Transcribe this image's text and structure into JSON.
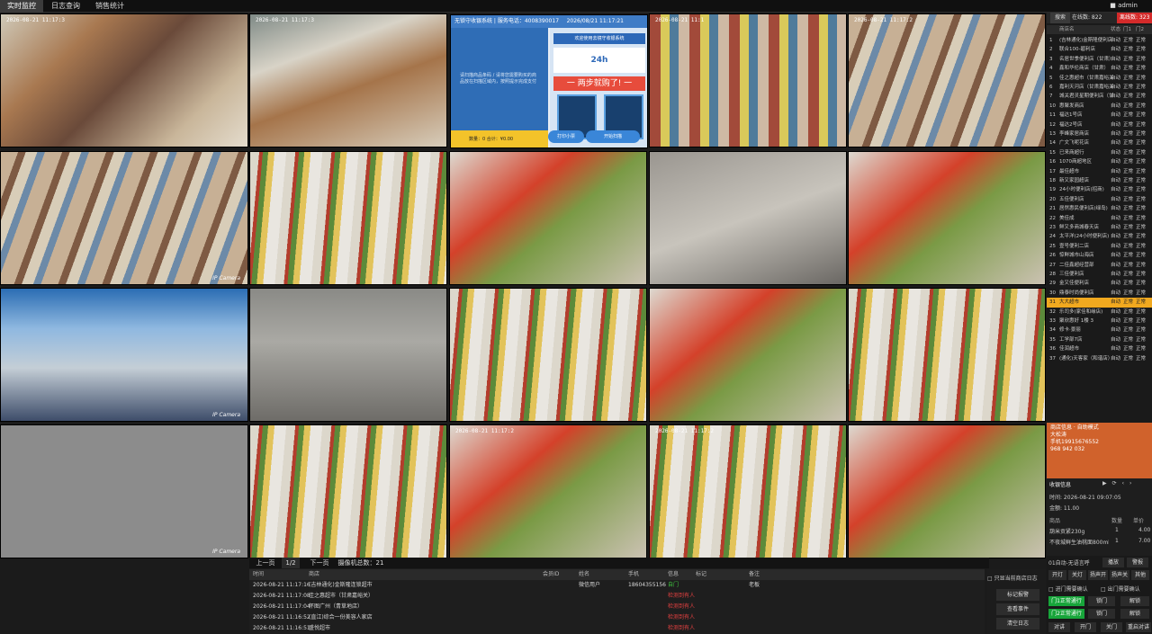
{
  "tabs": [
    {
      "label": "实时监控",
      "active": true
    },
    {
      "label": "日志查询",
      "active": false
    },
    {
      "label": "销售统计",
      "active": false
    }
  ],
  "user": {
    "name": "admin"
  },
  "cameras": {
    "timestamps": [
      "2026-08-21 11:17:3",
      "2026-08-21 11:17:3",
      "",
      "2026-08-21 11:1",
      "2026-08-21 11:17:2",
      "",
      "",
      "",
      "",
      "",
      "",
      "",
      "",
      "",
      "",
      "",
      "",
      "2026-08-21 11:17:2",
      "2026-08-21 11:17:2"
    ],
    "labels": [
      "IP Camera",
      "IP Camera",
      "IP Camera"
    ]
  },
  "pos_screen": {
    "header": "无锁守收银系统 | 服务电话：4008390017",
    "datetime": "2026/08/21 11:17:21",
    "message": "请扫描商品条码 / 请将您需要购买的商品放在扫描区域内，按照提示完成支付",
    "totals": "数量：0  合计：¥0.00",
    "ad_title": "欢迎使用去镜守收银系统",
    "ad_24h": "24h",
    "ad_slogan": "一 两步就购了! 一",
    "btn_left": "打印小票",
    "btn_right": "开始扫描"
  },
  "pager": {
    "prev": "上一页",
    "page": "1/2",
    "next": "下一页",
    "total_label": "摄像机总数：21"
  },
  "log": {
    "headers": [
      "时间",
      "商店",
      "会员ID",
      "姓名",
      "手机",
      "信息",
      "标记",
      "备注"
    ],
    "rows": [
      {
        "time": "2026-08-21 11:17:16",
        "store": "(吉林通化)金斯隆连锁超市",
        "member": "",
        "name": "微信用户",
        "phone": "18604355156",
        "info": "自门",
        "info_color": "green",
        "mark": "",
        "note": "老板"
      },
      {
        "time": "2026-08-21 11:17:08",
        "store": "佳之惠超市（甘肃嘉峪关）",
        "member": "",
        "name": "",
        "phone": "",
        "info": "检测到有人",
        "info_color": "red",
        "mark": "",
        "note": ""
      },
      {
        "time": "2026-08-21 11:17:04",
        "store": "怀图广州（青草地店）",
        "member": "",
        "name": "",
        "phone": "",
        "info": "检测到有人",
        "info_color": "red",
        "mark": "",
        "note": ""
      },
      {
        "time": "2026-08-21 11:16:52",
        "store": "(直江)综合一份美容人家店",
        "member": "",
        "name": "",
        "phone": "",
        "info": "检测到有人",
        "info_color": "red",
        "mark": "",
        "note": ""
      },
      {
        "time": "2026-08-21 11:16:51",
        "store": "盛悦超市",
        "member": "",
        "name": "",
        "phone": "",
        "info": "检测到有人",
        "info_color": "red",
        "mark": "",
        "note": ""
      }
    ]
  },
  "log_buttons": {
    "checkbox": "只显当前商店日志",
    "b1": "标记报警",
    "b2": "查看事件",
    "b3": "清空日志"
  },
  "sidebar": {
    "search_label": "搜索",
    "online_label": "在线数: 822",
    "offline_label": "离线数: 323",
    "headers": [
      "商店名",
      "状态",
      "门1",
      "门2"
    ],
    "stores": [
      {
        "no": "1",
        "name": "(吉林通化)金斯隆便利店",
        "status": "自动",
        "d1": "正常",
        "d2": "正常",
        "sel": false
      },
      {
        "no": "2",
        "name": "联合100-碧利店",
        "status": "自动",
        "d1": "正常",
        "d2": "正常",
        "sel": false
      },
      {
        "no": "3",
        "name": "名居世季便利店（甘肃）",
        "status": "自动",
        "d1": "正常",
        "d2": "正常",
        "sel": false
      },
      {
        "no": "4",
        "name": "鑫和华伦商店（甘肃）",
        "status": "自动",
        "d1": "正常",
        "d2": "正常",
        "sel": false
      },
      {
        "no": "5",
        "name": "佳之惠超市（甘肃嘉峪关）",
        "status": "自动",
        "d1": "正常",
        "d2": "正常",
        "sel": false
      },
      {
        "no": "6",
        "name": "嘉利天河店（甘肃嘉峪关）",
        "status": "自动",
        "d1": "正常",
        "d2": "正常",
        "sel": false
      },
      {
        "no": "7",
        "name": "城关君灵星期便利店（甘肃）",
        "status": "自动",
        "d1": "正常",
        "d2": "正常",
        "sel": false
      },
      {
        "no": "10",
        "name": "惠聚发商店",
        "status": "自动",
        "d1": "正常",
        "d2": "正常",
        "sel": false
      },
      {
        "no": "11",
        "name": "福达1号店",
        "status": "自动",
        "d1": "正常",
        "d2": "正常",
        "sel": false
      },
      {
        "no": "12",
        "name": "福达2号店",
        "status": "自动",
        "d1": "正常",
        "d2": "正常",
        "sel": false
      },
      {
        "no": "13",
        "name": "李峰家居商店",
        "status": "自动",
        "d1": "正常",
        "d2": "正常",
        "sel": false
      },
      {
        "no": "14",
        "name": "广文飞呢花店",
        "status": "自动",
        "d1": "正常",
        "d2": "正常",
        "sel": false
      },
      {
        "no": "15",
        "name": "已来商超行",
        "status": "自动",
        "d1": "正常",
        "d2": "正常",
        "sel": false
      },
      {
        "no": "16",
        "name": "1070商超地区",
        "status": "自动",
        "d1": "正常",
        "d2": "正常",
        "sel": false
      },
      {
        "no": "17",
        "name": "最佳超市",
        "status": "自动",
        "d1": "正常",
        "d2": "正常",
        "sel": false
      },
      {
        "no": "18",
        "name": "新又家园超店",
        "status": "自动",
        "d1": "正常",
        "d2": "正常",
        "sel": false
      },
      {
        "no": "19",
        "name": "24小时便利店(招商)",
        "status": "自动",
        "d1": "正常",
        "d2": "正常",
        "sel": false
      },
      {
        "no": "20",
        "name": "五佳便利店",
        "status": "自动",
        "d1": "正常",
        "d2": "正常",
        "sel": false
      },
      {
        "no": "21",
        "name": "居然惠民便利店(绿岛)",
        "status": "自动",
        "d1": "正常",
        "d2": "正常",
        "sel": false
      },
      {
        "no": "22",
        "name": "美佳成",
        "status": "自动",
        "d1": "正常",
        "d2": "正常",
        "sel": false
      },
      {
        "no": "23",
        "name": "鲜又多商城春天店",
        "status": "自动",
        "d1": "正常",
        "d2": "正常",
        "sel": false
      },
      {
        "no": "24",
        "name": "太平洋(24小时便利店)",
        "status": "自动",
        "d1": "正常",
        "d2": "正常",
        "sel": false
      },
      {
        "no": "25",
        "name": "壹号便利二店",
        "status": "自动",
        "d1": "正常",
        "d2": "正常",
        "sel": false
      },
      {
        "no": "26",
        "name": "惊鲜城市山海店",
        "status": "自动",
        "d1": "正常",
        "d2": "正常",
        "sel": false
      },
      {
        "no": "27",
        "name": "二佳鑫超经营部",
        "status": "自动",
        "d1": "正常",
        "d2": "正常",
        "sel": false
      },
      {
        "no": "28",
        "name": "三佳便利店",
        "status": "自动",
        "d1": "正常",
        "d2": "正常",
        "sel": false
      },
      {
        "no": "29",
        "name": "金又佳便利店",
        "status": "自动",
        "d1": "正常",
        "d2": "正常",
        "sel": false
      },
      {
        "no": "30",
        "name": "鼎泰时尚便利店",
        "status": "自动",
        "d1": "正常",
        "d2": "正常",
        "sel": false
      },
      {
        "no": "31",
        "name": "大大超市",
        "status": "自动",
        "d1": "正常",
        "d2": "正常",
        "sel": true
      },
      {
        "no": "32",
        "name": "乐司多(家佳和缘店)",
        "status": "自动",
        "d1": "正常",
        "d2": "正常",
        "sel": false
      },
      {
        "no": "33",
        "name": "聚欣惠好 1楼 3",
        "status": "自动",
        "d1": "正常",
        "d2": "正常",
        "sel": false
      },
      {
        "no": "34",
        "name": "修卡·景丽",
        "status": "自动",
        "d1": "正常",
        "d2": "正常",
        "sel": false
      },
      {
        "no": "35",
        "name": "工学部7店",
        "status": "自动",
        "d1": "正常",
        "d2": "正常",
        "sel": false
      },
      {
        "no": "36",
        "name": "佳润超市",
        "status": "自动",
        "d1": "正常",
        "d2": "正常",
        "sel": false
      },
      {
        "no": "37",
        "name": "(通化)天客家（和谐店）",
        "status": "自动",
        "d1": "正常",
        "d2": "正常",
        "sel": false
      }
    ],
    "store_info": {
      "title": "商店信息 · 自助模式",
      "name": "大松涛",
      "phone1": "手机19915676552",
      "phone2": "968 942 032"
    },
    "receipt": {
      "title": "收银信息",
      "time": "时间: 2026-08-21 09:07:05",
      "amount": "金额: 11.00",
      "headers": [
        "商品",
        "数量",
        "单价"
      ],
      "items": [
        {
          "name": "葫米贡紧230g",
          "qty": "1",
          "price": "4.00"
        },
        {
          "name": "不夜城鲜生油桃面800ml",
          "qty": "1",
          "price": "7.00"
        }
      ]
    },
    "controls": {
      "mode_text": "01自动-无语言呼",
      "mode_btn1": "播放",
      "mode_btn2": "警报",
      "row1": [
        "开灯",
        "关灯",
        "扬声开",
        "扬声关",
        "其他"
      ],
      "door_check1": "进门需要确认",
      "door_check2": "出门需要确认",
      "door1_status": "门1正常通行",
      "door1_b1": "锁门",
      "door1_b2": "解锁",
      "door2_status": "门2正常通行",
      "door2_b1": "锁门",
      "door2_b2": "解锁",
      "row_last": [
        "对讲",
        "开门",
        "关门",
        "重启对讲"
      ]
    }
  }
}
